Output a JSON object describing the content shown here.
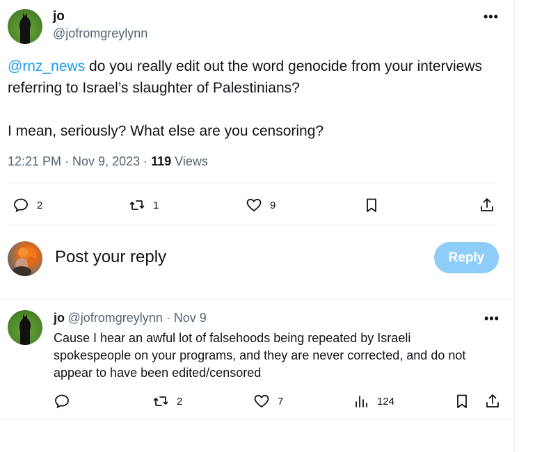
{
  "tweet": {
    "author_name": "jo",
    "author_handle": "@jofromgreylynn",
    "more": "•••",
    "mention": "@rnz_news",
    "text_line1": " do you really edit out the word genocide from your interviews",
    "text_line2": "referring to Israel’s slaughter of Palestinians?",
    "text_line3": "I mean, seriously? What else are you censoring?",
    "time": "12:21 PM · Nov 9, 2023 · ",
    "views_count": "119",
    "views_label": " Views",
    "replies": "2",
    "reposts": "1",
    "likes": "9"
  },
  "composer": {
    "placeholder": "Post your reply",
    "button": "Reply"
  },
  "reply": {
    "author_name": "jo",
    "author_handle": "@jofromgreylynn",
    "date": " · Nov 9",
    "more": "•••",
    "line1": "Cause I hear an awful lot of falsehoods being repeated by Israeli",
    "line2": "spokespeople on your programs, and they are never corrected, and do not",
    "line3": "appear to have been edited/censored",
    "replies": "",
    "reposts": "2",
    "likes": "7",
    "views": "124"
  },
  "icons": {
    "reply": "speech-bubble-icon",
    "repost": "repost-arrows-icon",
    "like": "heart-icon",
    "bookmark": "bookmark-icon",
    "share": "share-icon",
    "views": "bar-chart-icon",
    "more": "more-dots-icon"
  },
  "colors": {
    "accent": "#1d9bf0",
    "reply_button": "#8ecdf8",
    "secondary_text": "#536471"
  }
}
